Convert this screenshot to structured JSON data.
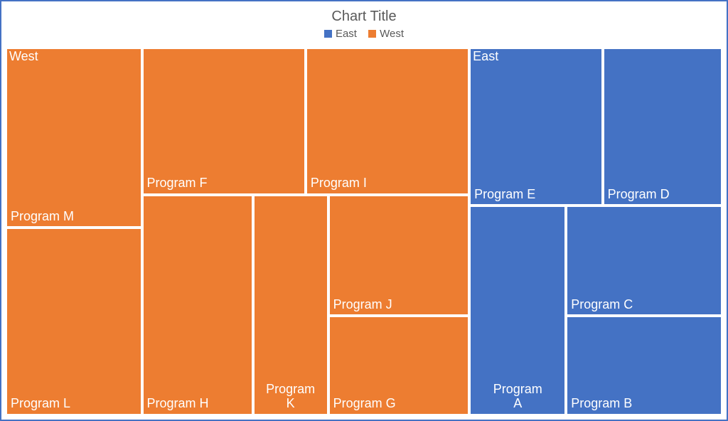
{
  "chart_data": {
    "type": "treemap",
    "title": "Chart Title",
    "legend": [
      {
        "name": "East",
        "color": "#4472C4"
      },
      {
        "name": "West",
        "color": "#ED7D31"
      }
    ],
    "series": [
      {
        "name": "West",
        "color": "#ED7D31",
        "items": [
          {
            "label": "Program M",
            "value": 95
          },
          {
            "label": "Program L",
            "value": 95
          },
          {
            "label": "Program F",
            "value": 80
          },
          {
            "label": "Program I",
            "value": 80
          },
          {
            "label": "Program H",
            "value": 85
          },
          {
            "label": "Program K",
            "value": 55
          },
          {
            "label": "Program J",
            "value": 55
          },
          {
            "label": "Program G",
            "value": 45
          }
        ]
      },
      {
        "name": "East",
        "color": "#4472C4",
        "items": [
          {
            "label": "Program E",
            "value": 75
          },
          {
            "label": "Program D",
            "value": 70
          },
          {
            "label": "Program A",
            "value": 70
          },
          {
            "label": "Program C",
            "value": 50
          },
          {
            "label": "Program B",
            "value": 45
          }
        ]
      }
    ]
  },
  "tiles": {
    "title": "Chart Title",
    "west_region": "West",
    "east_region": "East",
    "m": "Program M",
    "l": "Program L",
    "f": "Program F",
    "i": "Program I",
    "h": "Program H",
    "k": "Program\nK",
    "j": "Program J",
    "g": "Program G",
    "e": "Program E",
    "d": "Program D",
    "a": "Program\nA",
    "c": "Program C",
    "b": "Program B"
  },
  "legend": {
    "east": "East",
    "west": "West"
  },
  "colors": {
    "east": "#4472C4",
    "west": "#ED7D31"
  }
}
